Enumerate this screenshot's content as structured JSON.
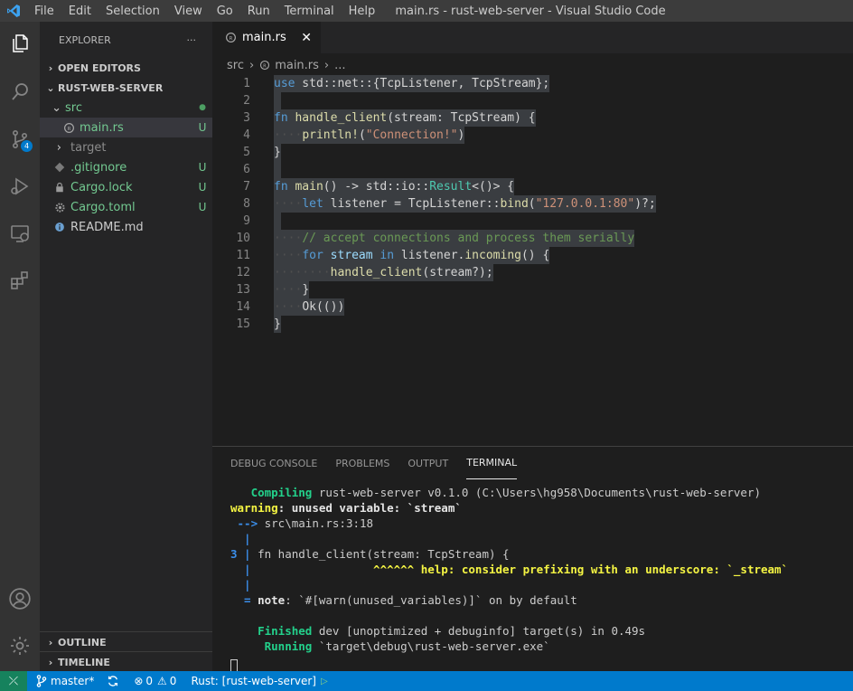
{
  "titlebar": {
    "menu": [
      "File",
      "Edit",
      "Selection",
      "View",
      "Go",
      "Run",
      "Terminal",
      "Help"
    ],
    "window_title": "main.rs - rust-web-server - Visual Studio Code"
  },
  "activitybar": {
    "scm_badge": "4"
  },
  "sidebar": {
    "header": "EXPLORER",
    "more": "···",
    "open_editors": "OPEN EDITORS",
    "project": "RUST-WEB-SERVER",
    "tree": [
      {
        "label": "src",
        "status": "●"
      },
      {
        "label": "main.rs",
        "status": "U"
      },
      {
        "label": "target",
        "status": ""
      },
      {
        "label": ".gitignore",
        "status": "U"
      },
      {
        "label": "Cargo.lock",
        "status": "U"
      },
      {
        "label": "Cargo.toml",
        "status": "U"
      },
      {
        "label": "README.md",
        "status": ""
      }
    ],
    "outline": "OUTLINE",
    "timeline": "TIMELINE"
  },
  "editor": {
    "tab_label": "main.rs",
    "breadcrumb": [
      "src",
      "main.rs",
      "..."
    ],
    "line_numbers": [
      "1",
      "2",
      "3",
      "4",
      "5",
      "6",
      "7",
      "8",
      "9",
      "10",
      "11",
      "12",
      "13",
      "14",
      "15"
    ],
    "code": {
      "l1_use": "use",
      "l1_rest": " std::net::{TcpListener, TcpStream};",
      "l3_fn": "fn",
      "l3_name": " handle_client",
      "l3_rest": "(stream: TcpStream) {",
      "l4_macro": "println!",
      "l4_str": "\"Connection!\"",
      "l5": "}",
      "l7_fn": "fn",
      "l7_name": " main",
      "l7_rest": "() -> std::io::",
      "l7_type": "Result",
      "l7_end": "<()> {",
      "l8_let": "let",
      "l8_mid": " listener = TcpListener::",
      "l8_bind": "bind",
      "l8_str": "\"127.0.0.1:80\"",
      "l8_end": ")?;",
      "l10_comment": "// accept connections and process them serially",
      "l11_for": "for",
      "l11_stream": " stream ",
      "l11_in": "in",
      "l11_rest": " listener.",
      "l11_incoming": "incoming",
      "l11_end": "() {",
      "l12_call": "handle_client",
      "l12_rest": "(stream?);",
      "l13": "}",
      "l14": "Ok(())",
      "l15": "}"
    }
  },
  "panel": {
    "tabs": [
      "DEBUG CONSOLE",
      "PROBLEMS",
      "OUTPUT",
      "TERMINAL"
    ],
    "terminal": {
      "t1_label": "   Compiling",
      "t1_rest": " rust-web-server v0.1.0 (C:\\Users\\hg958\\Documents\\rust-web-server)",
      "t2_label": "warning",
      "t2_rest": ": unused variable: `stream`",
      "t3_arrow": " -->",
      "t3_rest": " src\\main.rs:3:18",
      "t4_bar": "  |",
      "t5_num": "3 |",
      "t5_rest": " fn handle_client(stream: TcpStream) {",
      "t6_bar": "  |",
      "t6_rest": "                  ^^^^^^ help: consider prefixing with an underscore: `_stream`",
      "t7_bar": "  |",
      "t8_eq": "  =",
      "t8_note": " note",
      "t8_rest": ": `#[warn(unused_variables)]` on by default",
      "t10_label": "    Finished",
      "t10_rest": " dev [unoptimized + debuginfo] target(s) in 0.49s",
      "t11_label": "     Running",
      "t11_rest": " `target\\debug\\rust-web-server.exe`"
    }
  },
  "statusbar": {
    "branch": "master*",
    "errors": "0",
    "warnings": "0",
    "run_config": "Rust: [rust-web-server]"
  },
  "colors": {
    "accent": "#007acc",
    "remote": "#16825d",
    "untracked": "#73c991"
  }
}
